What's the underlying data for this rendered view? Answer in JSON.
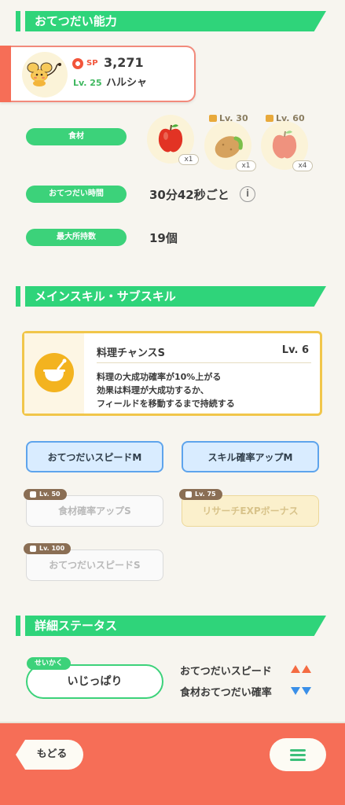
{
  "sections": {
    "help_ability": "おてつだい能力",
    "skills": "メインスキル・サブスキル",
    "details": "詳細ステータス"
  },
  "pokemon": {
    "sp_label": "SP",
    "sp_value": "3,271",
    "level": "Lv. 25",
    "name": "ハルシャ"
  },
  "stats": {
    "ingredients_label": "食材",
    "help_time_label": "おてつだい時間",
    "help_time_value": "30分42秒ごと",
    "max_carry_label": "最大所持数",
    "max_carry_value": "19個"
  },
  "ingredients": [
    {
      "name": "apple",
      "count": "x1",
      "unlock": ""
    },
    {
      "name": "potato",
      "count": "x1",
      "unlock": "Lv. 30"
    },
    {
      "name": "apple",
      "count": "x4",
      "unlock": "Lv. 60"
    }
  ],
  "main_skill": {
    "name": "料理チャンスS",
    "level": "Lv. 6",
    "description": "料理の大成功確率が10%上がる\n効果は料理が大成功するか、\nフィールドを移動するまで持続する"
  },
  "sub_skills": [
    {
      "label": "おてつだいスピードM",
      "state": "active",
      "unlock": ""
    },
    {
      "label": "スキル確率アップM",
      "state": "active",
      "unlock": ""
    },
    {
      "label": "食材確率アップS",
      "state": "locked",
      "unlock": "Lv. 50"
    },
    {
      "label": "リサーチEXPボーナス",
      "state": "gold",
      "unlock": "Lv. 75"
    },
    {
      "label": "おてつだいスピードS",
      "state": "locked",
      "unlock": "Lv. 100"
    }
  ],
  "nature": {
    "tag": "せいかく",
    "name": "いじっぱり",
    "up_label": "おてつだいスピード",
    "down_label": "食材おてつだい確率"
  },
  "bottom": {
    "back_label": "もどる"
  },
  "colors": {
    "accent_green": "#2fd47a",
    "accent_orange": "#f66e57",
    "up": "#f46b42",
    "down": "#3a8fe8"
  }
}
